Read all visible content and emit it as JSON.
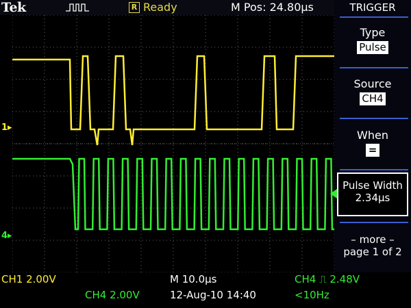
{
  "header": {
    "logo": "Tek",
    "run_state_badge": "R",
    "status": "Ready",
    "m_pos": "M Pos: 24.80µs"
  },
  "menu": {
    "title": "TRIGGER",
    "items": [
      {
        "label": "Type",
        "value": "Pulse"
      },
      {
        "label": "Source",
        "value": "CH4"
      },
      {
        "label": "When",
        "value": "="
      }
    ],
    "pulse_width": {
      "label": "Pulse Width",
      "value": "2.34µs"
    },
    "more": {
      "label": "– more –",
      "page": "page 1 of 2"
    }
  },
  "channels": {
    "ch1_marker": "1",
    "ch4_marker": "4"
  },
  "readout": {
    "ch1": "CH1  2.00V",
    "ch4": "CH4  2.00V",
    "timebase": "M 10.0µs",
    "date": "12-Aug-10 14:40",
    "trigger": "CH4 ⎍ 2.48V",
    "freq": "<10Hz"
  },
  "colors": {
    "ch1": "#ffee33",
    "ch4": "#33ee33",
    "grid": "#6a6a6a",
    "accent": "#3a5fd0"
  }
}
